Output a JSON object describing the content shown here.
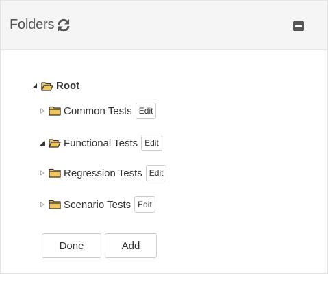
{
  "panel": {
    "title": "Folders",
    "refresh_icon": "refresh-icon",
    "collapse_icon": "minus-square-icon"
  },
  "tree": {
    "root": {
      "label": "Root",
      "state": "expanded",
      "icon": "folder-open-icon"
    },
    "children": [
      {
        "label": "Common Tests",
        "state": "collapsed",
        "icon": "folder-closed-icon",
        "edit_label": "Edit"
      },
      {
        "label": "Functional Tests",
        "state": "expanded",
        "icon": "folder-open-icon",
        "edit_label": "Edit"
      },
      {
        "label": "Regression Tests",
        "state": "collapsed",
        "icon": "folder-closed-icon",
        "edit_label": "Edit"
      },
      {
        "label": "Scenario Tests",
        "state": "collapsed",
        "icon": "folder-closed-icon",
        "edit_label": "Edit"
      }
    ]
  },
  "actions": {
    "done_label": "Done",
    "add_label": "Add"
  },
  "colors": {
    "folder_fill": "#f3c65a",
    "folder_stroke": "#333333",
    "header_bg": "#f5f5f5",
    "text": "#333333"
  }
}
